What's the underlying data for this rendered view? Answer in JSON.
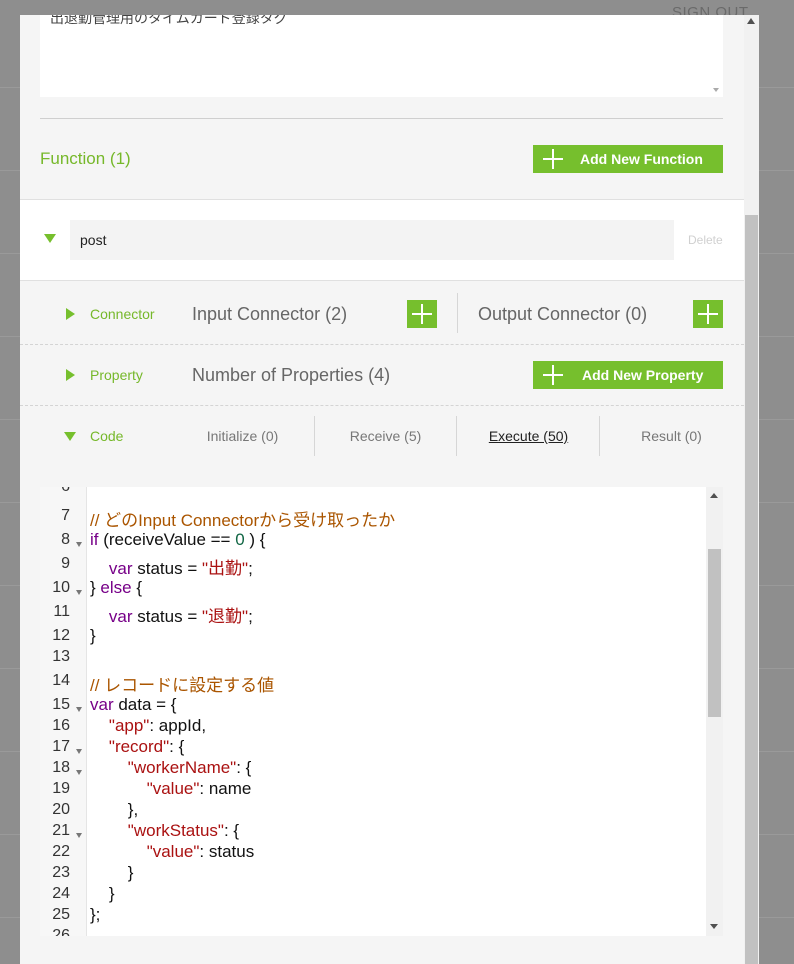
{
  "header": {
    "signout": "SIGN OUT"
  },
  "description": {
    "text": "出退勤管理用のタイムカード登録タグ"
  },
  "function_section": {
    "title": "Function (1)",
    "add_button": "Add New Function"
  },
  "function": {
    "name": "post",
    "delete": "Delete"
  },
  "connector": {
    "label": "Connector",
    "input": "Input Connector (2)",
    "output": "Output Connector (0)"
  },
  "property": {
    "label": "Property",
    "count": "Number of Properties (4)",
    "add_button": "Add New Property"
  },
  "code": {
    "label": "Code",
    "tabs": [
      "Initialize (0)",
      "Receive (5)",
      "Execute (50)",
      "Result (0)"
    ],
    "active_tab": "Execute (50)",
    "first_line": 6,
    "lines": [
      "",
      "// どのInput Connectorから受け取ったか",
      "if (receiveValue == 0 ) {",
      "    var status = \"出勤\";",
      "} else {",
      "    var status = \"退勤\";",
      "}",
      "",
      "// レコードに設定する値",
      "var data = {",
      "    \"app\": appId,",
      "    \"record\": {",
      "        \"workerName\": {",
      "            \"value\": name",
      "        },",
      "        \"workStatus\": {",
      "            \"value\": status",
      "        }",
      "    }",
      "};"
    ],
    "folds": [
      8,
      10,
      15,
      17,
      18,
      21
    ]
  },
  "colors": {
    "accent": "#76bf2d",
    "label": "#76b82a"
  }
}
